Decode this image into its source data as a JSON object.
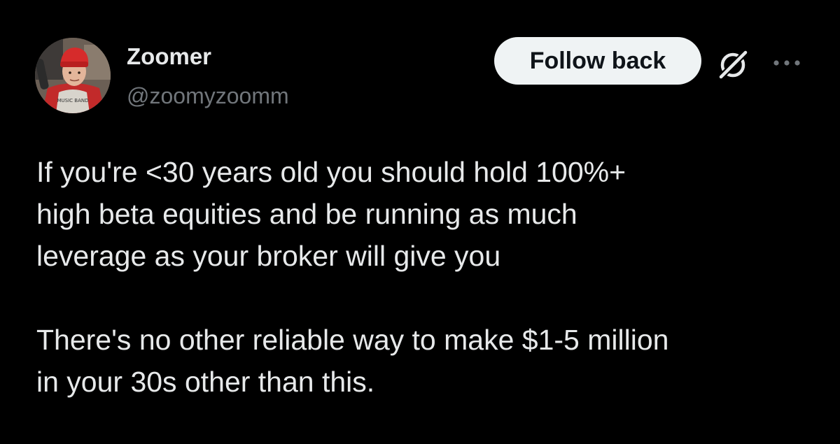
{
  "post": {
    "author": {
      "display_name": "Zoomer",
      "handle": "@zoomyzoomm",
      "avatar_icon": "profile-photo"
    },
    "follow_button_label": "Follow back",
    "icons": {
      "grok": "grok-icon",
      "more": "more-icon"
    },
    "paragraphs": [
      "If you're <30 years old you should hold 100%+\nhigh beta equities and be running as much\nleverage as your broker will give you",
      "There's no other reliable way to make $1-5 million\nin your 30s other than this."
    ]
  },
  "colors": {
    "background": "#000000",
    "text_primary": "#e7e9ea",
    "text_secondary": "#71767b",
    "button_bg": "#eff3f4",
    "button_text": "#0f1419"
  }
}
